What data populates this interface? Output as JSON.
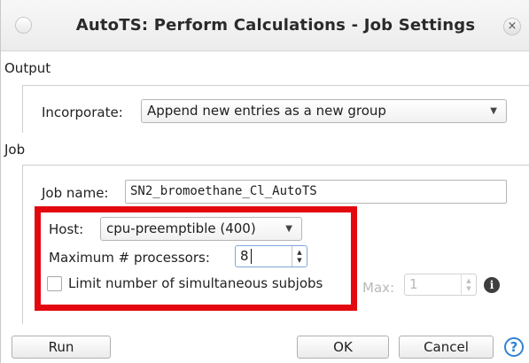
{
  "window": {
    "title": "AutoTS: Perform Calculations - Job Settings",
    "close_glyph": "×"
  },
  "output": {
    "section_label": "Output",
    "incorporate_label": "Incorporate:",
    "incorporate_value": "Append new entries as a new group"
  },
  "job": {
    "section_label": "Job",
    "job_name_label": "Job name:",
    "job_name_value": "SN2_bromoethane_Cl_AutoTS",
    "host_label": "Host:",
    "host_value": "cpu-preemptible (400)",
    "max_processors_label": "Maximum # processors:",
    "max_processors_value": "8",
    "limit_subjobs_label": "Limit number of simultaneous subjobs",
    "limit_subjobs_checked": false,
    "max_label": "Max:",
    "max_value": "1"
  },
  "buttons": {
    "run": "Run",
    "ok": "OK",
    "cancel": "Cancel",
    "help_glyph": "?",
    "info_glyph": "i"
  },
  "colors": {
    "highlight_frame": "#e3080f",
    "help_accent": "#2f84d6"
  }
}
